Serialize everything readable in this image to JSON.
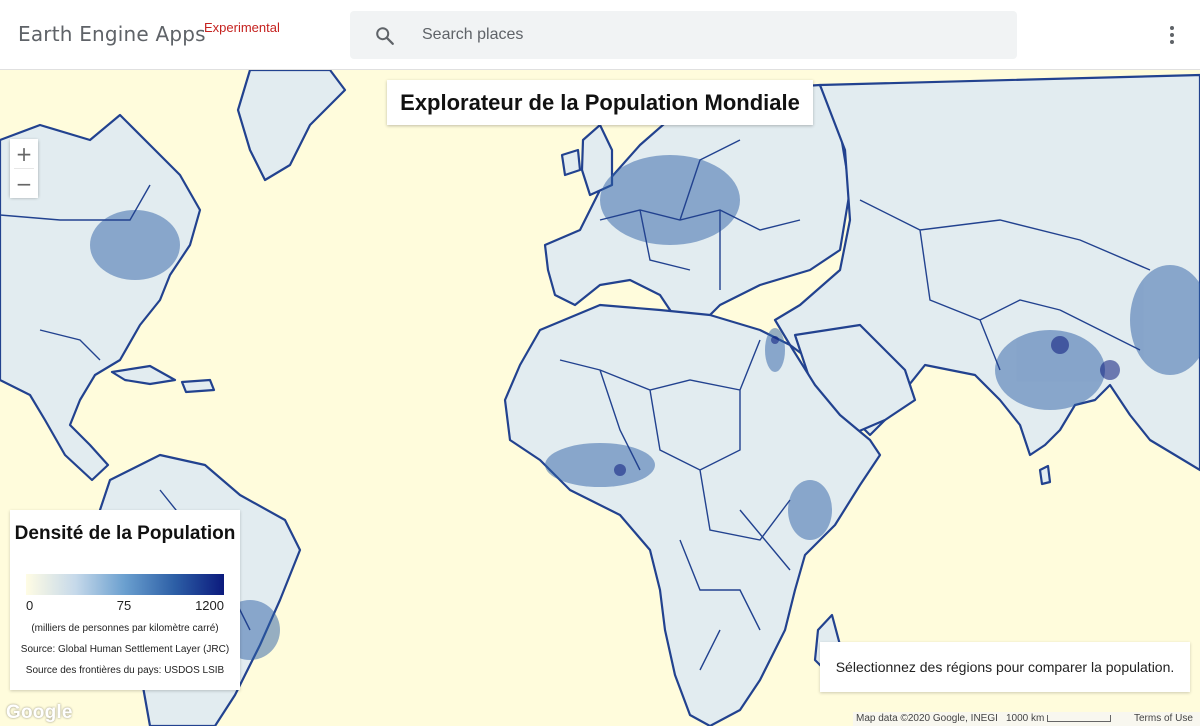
{
  "header": {
    "brand": "Earth Engine Apps",
    "badge": "Experimental",
    "search_placeholder": "Search places",
    "search_icon": "search-icon",
    "menu_icon": "more-vert-icon"
  },
  "map": {
    "title": "Explorateur de la Population Mondiale",
    "zoom_in": "+",
    "zoom_out": "−",
    "legend": {
      "title": "Densité de la Population",
      "min": "0",
      "mid": "75",
      "max": "1200",
      "units": "(milliers de personnes par kilomètre carré)",
      "source": "Source: Global Human Settlement Layer (JRC)",
      "boundaries": "Source des frontières du pays: USDOS LSIB",
      "colors": [
        "#fffce4",
        "#c6d9ea",
        "#6a9fcf",
        "#2d5fa6",
        "#0b1a7d"
      ]
    },
    "info": "Sélectionnez des régions pour comparer la population.",
    "google_logo": "Google",
    "attribution": {
      "map_data": "Map data ©2020 Google, INEGI",
      "scale": "1000 km",
      "terms": "Terms of Use"
    },
    "colors": {
      "background": "#fffcdc",
      "land": "#e2ecf0",
      "border": "#22428f"
    }
  }
}
